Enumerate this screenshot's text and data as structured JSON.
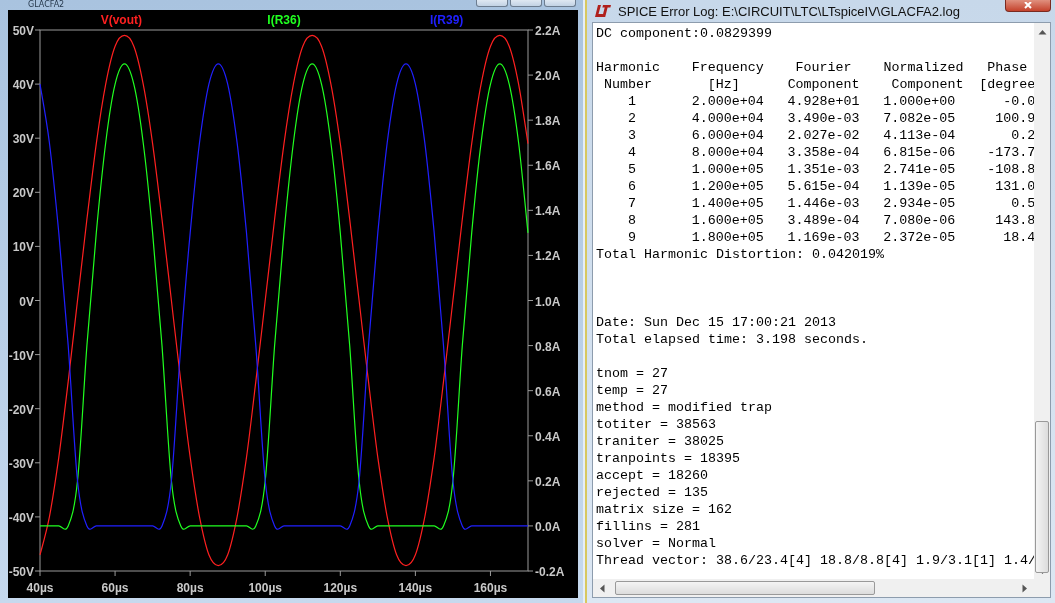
{
  "plot_window": {
    "title": "GLACFA2",
    "chart_data": {
      "type": "line",
      "xlim": [
        40,
        170
      ],
      "ylim": [
        -50,
        50
      ],
      "y2lim": [
        -0.2,
        2.2
      ],
      "xticks": [
        {
          "value": 40,
          "label": "40µs"
        },
        {
          "value": 60,
          "label": "60µs"
        },
        {
          "value": 80,
          "label": "80µs"
        },
        {
          "value": 100,
          "label": "100µs"
        },
        {
          "value": 120,
          "label": "120µs"
        },
        {
          "value": 140,
          "label": "140µs"
        },
        {
          "value": 160,
          "label": "160µs"
        }
      ],
      "yticks": [
        {
          "value": 50,
          "label": "50V"
        },
        {
          "value": 40,
          "label": "40V"
        },
        {
          "value": 30,
          "label": "30V"
        },
        {
          "value": 20,
          "label": "20V"
        },
        {
          "value": 10,
          "label": "10V"
        },
        {
          "value": 0,
          "label": "0V"
        },
        {
          "value": -10,
          "label": "-10V"
        },
        {
          "value": -20,
          "label": "-20V"
        },
        {
          "value": -30,
          "label": "-30V"
        },
        {
          "value": -40,
          "label": "-40V"
        },
        {
          "value": -50,
          "label": "-50V"
        }
      ],
      "y2ticks": [
        {
          "value": 2.2,
          "label": "2.2A"
        },
        {
          "value": 2.0,
          "label": "2.0A"
        },
        {
          "value": 1.8,
          "label": "1.8A"
        },
        {
          "value": 1.6,
          "label": "1.6A"
        },
        {
          "value": 1.4,
          "label": "1.4A"
        },
        {
          "value": 1.2,
          "label": "1.2A"
        },
        {
          "value": 1.0,
          "label": "1.0A"
        },
        {
          "value": 0.8,
          "label": "0.8A"
        },
        {
          "value": 0.6,
          "label": "0.6A"
        },
        {
          "value": 0.4,
          "label": "0.4A"
        },
        {
          "value": 0.2,
          "label": "0.2A"
        },
        {
          "value": 0.0,
          "label": "0.0A"
        },
        {
          "value": -0.2,
          "label": "-0.2A"
        }
      ],
      "x": [
        40,
        42.5,
        45,
        47.5,
        50,
        52.5,
        55,
        57.5,
        60,
        62.5,
        65,
        67.5,
        70,
        72.5,
        75,
        77.5,
        80,
        82.5,
        85,
        87.5,
        90,
        92.5,
        95,
        97.5,
        100,
        102.5,
        105,
        107.5,
        110,
        112.5,
        115,
        117.5,
        120,
        122.5,
        125,
        127.5,
        130,
        132.5,
        135,
        137.5,
        140,
        142.5,
        145,
        147.5,
        150,
        152.5,
        155,
        157.5,
        160,
        162.5,
        165,
        167.5,
        170
      ],
      "series": [
        {
          "name": "V(vout)",
          "color": "#ff2020",
          "values": [
            -47,
            -40,
            -29,
            -15,
            0,
            15,
            29,
            40,
            47,
            49,
            47,
            40,
            29,
            15,
            0,
            -15,
            -29,
            -40,
            -47,
            -49,
            -47,
            -40,
            -29,
            -15,
            0,
            15,
            29,
            40,
            47,
            49,
            47,
            40,
            29,
            15,
            0,
            -15,
            -29,
            -40,
            -47,
            -49,
            -47,
            -40,
            -29,
            -15,
            0,
            15,
            29,
            40,
            47,
            49,
            47,
            40,
            29
          ]
        },
        {
          "name": "I(R36)",
          "color": "#20ff20",
          "axis": "y2",
          "values": [
            0,
            0,
            0,
            0,
            0.2,
            0.8,
            1.3,
            1.7,
            1.96,
            2.05,
            1.96,
            1.7,
            1.3,
            0.8,
            0.2,
            0,
            0,
            0,
            0,
            0,
            0,
            0,
            0,
            0,
            0.2,
            0.8,
            1.3,
            1.7,
            1.96,
            2.05,
            1.96,
            1.7,
            1.3,
            0.8,
            0.2,
            0,
            0,
            0,
            0,
            0,
            0,
            0,
            0,
            0,
            0.2,
            0.8,
            1.3,
            1.7,
            1.96,
            2.05,
            1.96,
            1.7,
            1.3
          ]
        },
        {
          "name": "I(R39)",
          "color": "#2020ff",
          "axis": "y2",
          "values": [
            1.96,
            1.7,
            1.3,
            0.8,
            0.2,
            0,
            0,
            0,
            0,
            0,
            0,
            0,
            0,
            0,
            0.2,
            0.8,
            1.3,
            1.7,
            1.96,
            2.05,
            1.96,
            1.7,
            1.3,
            0.8,
            0.2,
            0,
            0,
            0,
            0,
            0,
            0,
            0,
            0,
            0,
            0.2,
            0.8,
            1.3,
            1.7,
            1.96,
            2.05,
            1.96,
            1.7,
            1.3,
            0.8,
            0.2,
            0,
            0,
            0,
            0,
            0,
            0,
            0,
            0
          ]
        }
      ]
    }
  },
  "log_window": {
    "title": "SPICE Error Log: E:\\CIRCUIT\\LTC\\LTspiceIV\\GLACFA2.log",
    "entries": [
      {
        "kind": "line",
        "text": "DC component:0.0829399"
      },
      {
        "kind": "blank"
      },
      {
        "kind": "table",
        "header_rows": [
          [
            "Harmonic",
            "Frequency",
            "Fourier",
            "Normalized",
            "Phase"
          ],
          [
            "Number",
            "[Hz]",
            "Component",
            "Component",
            "[degree"
          ]
        ],
        "rows": [
          [
            "1",
            "2.000e+04",
            "4.928e+01",
            "1.000e+00",
            "-0.0"
          ],
          [
            "2",
            "4.000e+04",
            "3.490e-03",
            "7.082e-05",
            "100.9"
          ],
          [
            "3",
            "6.000e+04",
            "2.027e-02",
            "4.113e-04",
            "0.2"
          ],
          [
            "4",
            "8.000e+04",
            "3.358e-04",
            "6.815e-06",
            "-173.7"
          ],
          [
            "5",
            "1.000e+05",
            "1.351e-03",
            "2.741e-05",
            "-108.8"
          ],
          [
            "6",
            "1.200e+05",
            "5.615e-04",
            "1.139e-05",
            "131.0"
          ],
          [
            "7",
            "1.400e+05",
            "1.446e-03",
            "2.934e-05",
            "0.5"
          ],
          [
            "8",
            "1.600e+05",
            "3.489e-04",
            "7.080e-06",
            "143.8"
          ],
          [
            "9",
            "1.800e+05",
            "1.169e-03",
            "2.372e-05",
            "18.4"
          ]
        ]
      },
      {
        "kind": "line",
        "text": "Total Harmonic Distortion: 0.042019%"
      },
      {
        "kind": "blank"
      },
      {
        "kind": "blank"
      },
      {
        "kind": "blank"
      },
      {
        "kind": "line",
        "text": "Date: Sun Dec 15 17:00:21 2013"
      },
      {
        "kind": "line",
        "text": "Total elapsed time: 3.198 seconds."
      },
      {
        "kind": "blank"
      },
      {
        "kind": "line",
        "text": "tnom = 27"
      },
      {
        "kind": "line",
        "text": "temp = 27"
      },
      {
        "kind": "line",
        "text": "method = modified trap"
      },
      {
        "kind": "line",
        "text": "totiter = 38563"
      },
      {
        "kind": "line",
        "text": "traniter = 38025"
      },
      {
        "kind": "line",
        "text": "tranpoints = 18395"
      },
      {
        "kind": "line",
        "text": "accept = 18260"
      },
      {
        "kind": "line",
        "text": "rejected = 135"
      },
      {
        "kind": "line",
        "text": "matrix size = 162"
      },
      {
        "kind": "line",
        "text": "fillins = 281"
      },
      {
        "kind": "line",
        "text": "solver = Normal"
      },
      {
        "kind": "line",
        "text": "Thread vector: 38.6/23.4[4] 18.8/8.8[4] 1.9/3.1[1] 1.4/"
      }
    ]
  }
}
